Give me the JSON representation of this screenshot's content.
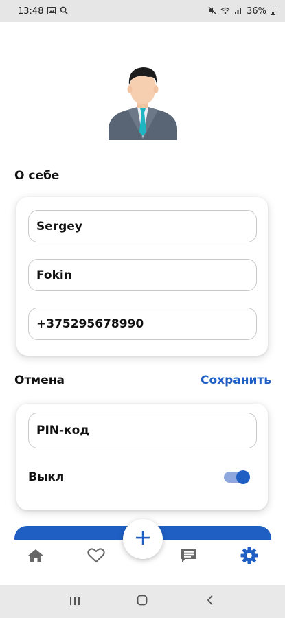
{
  "status_bar": {
    "time": "13:48",
    "battery": "36%",
    "left_icons": [
      "image-icon",
      "search-icon"
    ],
    "right_icons": [
      "mute-icon",
      "wifi-icon",
      "signal-icon",
      "battery-icon"
    ]
  },
  "profile": {
    "section_title": "О себе",
    "first_name": "Sergey",
    "last_name": "Fokin",
    "phone": "+375295678990"
  },
  "actions": {
    "cancel_label": "Отмена",
    "save_label": "Сохранить"
  },
  "security": {
    "pin_value": "PIN-код",
    "toggle_label": "Выкл",
    "toggle_on": true
  },
  "bottom_nav": {
    "items": [
      "home-icon",
      "heart-icon",
      "add-icon",
      "chat-icon",
      "settings-icon"
    ],
    "active": "settings-icon"
  },
  "colors": {
    "accent": "#1f5fc4",
    "toggle_track": "#8ea7dd",
    "nav_inactive": "#666666",
    "status_bar_bg": "#e6e6e6"
  }
}
